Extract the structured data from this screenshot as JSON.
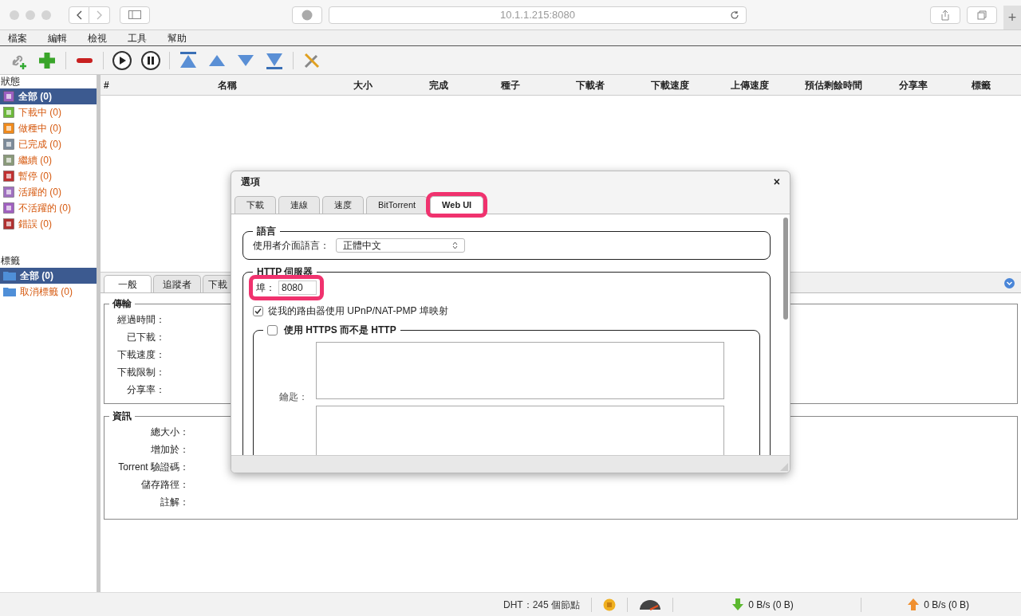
{
  "browser": {
    "url": "10.1.1.215:8080",
    "new_tab": "+"
  },
  "menu": [
    "檔案",
    "編輯",
    "檢視",
    "工具",
    "幫助"
  ],
  "sidebar": {
    "status_title": "狀態",
    "status_items": [
      {
        "label": "全部 (0)",
        "selected": true
      },
      {
        "label": "下載中 (0)",
        "selected": false
      },
      {
        "label": "做種中 (0)",
        "selected": false
      },
      {
        "label": "已完成 (0)",
        "selected": false
      },
      {
        "label": "繼續 (0)",
        "selected": false
      },
      {
        "label": "暫停 (0)",
        "selected": false
      },
      {
        "label": "活躍的 (0)",
        "selected": false
      },
      {
        "label": "不活躍的 (0)",
        "selected": false
      },
      {
        "label": "錯誤 (0)",
        "selected": false
      }
    ],
    "labels_title": "標籤",
    "label_items": [
      {
        "label": "全部 (0)",
        "selected": true
      },
      {
        "label": "取消標籤 (0)",
        "selected": false
      }
    ]
  },
  "table": {
    "columns": [
      "#",
      "名稱",
      "大小",
      "完成",
      "種子",
      "下載者",
      "下載速度",
      "上傳速度",
      "預估剩餘時間",
      "分享率",
      "標籤"
    ]
  },
  "detail_tabs": [
    {
      "label": "一般",
      "selected": true
    },
    {
      "label": "追蹤者",
      "selected": false
    },
    {
      "label": "下載",
      "selected": false
    }
  ],
  "transfer": {
    "title": "傳輸",
    "fields": [
      "經過時間：",
      "已下載：",
      "下載速度：",
      "下載限制：",
      "分享率："
    ]
  },
  "info": {
    "title": "資訊",
    "fields": [
      "總大小：",
      "增加於：",
      "Torrent 驗證碼：",
      "儲存路徑：",
      "註解："
    ]
  },
  "dialog": {
    "title": "選項",
    "close": "×",
    "tabs": [
      {
        "label": "下載",
        "selected": false
      },
      {
        "label": "連線",
        "selected": false
      },
      {
        "label": "速度",
        "selected": false
      },
      {
        "label": "BitTorrent",
        "selected": false
      },
      {
        "label": "Web UI",
        "selected": true,
        "highlighted": true
      }
    ],
    "language": {
      "title": "語言",
      "label": "使用者介面語言：",
      "value": "正體中文"
    },
    "http": {
      "title": "HTTP 伺服器",
      "port_label": "埠：",
      "port": "8080",
      "port_highlighted": true,
      "upnp": {
        "label": "從我的路由器使用 UPnP/NAT-PMP 埠映射",
        "checked": true
      },
      "https": {
        "label": "使用 HTTPS 而不是 HTTP",
        "checked": false
      },
      "key_label": "鑰匙："
    }
  },
  "status_bar": {
    "dht": "DHT：245 個節點",
    "download": "0 B/s (0 B)",
    "upload": "0 B/s (0 B)"
  }
}
